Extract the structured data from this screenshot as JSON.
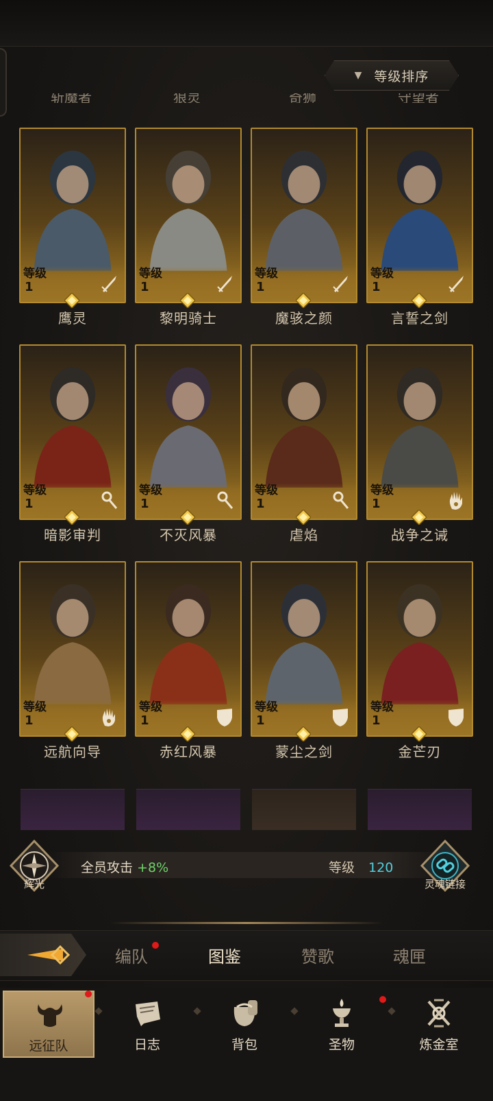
{
  "sort": {
    "label": "等级排序"
  },
  "cut_off_names": [
    "斩魔者",
    "狼灵",
    "奇狮",
    "守望者"
  ],
  "level_label": "等级",
  "heroes": [
    {
      "name": "鹰灵",
      "level": "1",
      "class_icon": "sword-icon"
    },
    {
      "name": "黎明骑士",
      "level": "1",
      "class_icon": "sword-icon"
    },
    {
      "name": "魔骇之颜",
      "level": "1",
      "class_icon": "sword-icon"
    },
    {
      "name": "言誓之剑",
      "level": "1",
      "class_icon": "sword-icon"
    },
    {
      "name": "暗影审判",
      "level": "1",
      "class_icon": "staff-icon"
    },
    {
      "name": "不灭风暴",
      "level": "1",
      "class_icon": "staff-icon"
    },
    {
      "name": "虐焰",
      "level": "1",
      "class_icon": "staff-icon"
    },
    {
      "name": "战争之诫",
      "level": "1",
      "class_icon": "palm-icon"
    },
    {
      "name": "远航向导",
      "level": "1",
      "class_icon": "palm-icon"
    },
    {
      "name": "赤红风暴",
      "level": "1",
      "class_icon": "shield-icon"
    },
    {
      "name": "蒙尘之剑",
      "level": "1",
      "class_icon": "shield-icon"
    },
    {
      "name": "金芒刃",
      "level": "1",
      "class_icon": "shield-icon"
    }
  ],
  "bonus": {
    "left_emblem": "辉光",
    "text": "全员攻击",
    "value": "+8%",
    "level_label": "等级",
    "level_value": "120",
    "right_emblem": "灵魂链接"
  },
  "subtabs": [
    {
      "label": "编队",
      "badge": true
    },
    {
      "label": "图鉴",
      "badge": false,
      "active": true
    },
    {
      "label": "赞歌",
      "badge": false
    },
    {
      "label": "魂匣",
      "badge": false
    }
  ],
  "nav": [
    {
      "label": "远征队",
      "icon": "horned-helmet-icon",
      "badge": true,
      "active": true
    },
    {
      "label": "日志",
      "icon": "scroll-icon",
      "badge": false
    },
    {
      "label": "背包",
      "icon": "bag-icon",
      "badge": false
    },
    {
      "label": "圣物",
      "icon": "chalice-icon",
      "badge": true
    },
    {
      "label": "炼金室",
      "icon": "alchemy-icon",
      "badge": false
    }
  ],
  "colors": {
    "accent_gold": "#b38a2e",
    "bonus_green": "#6fd36a",
    "level_cyan": "#4fd0e0",
    "badge_red": "#e01919"
  }
}
